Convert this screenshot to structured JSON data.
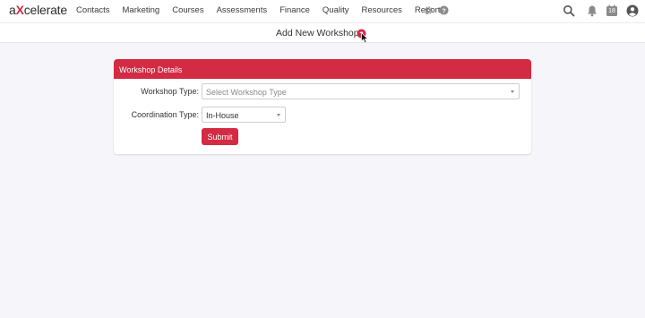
{
  "app": {
    "logo_prefix": "a",
    "logo_x": "X",
    "logo_suffix": "celerate"
  },
  "nav": {
    "items": [
      "Contacts",
      "Marketing",
      "Courses",
      "Assessments",
      "Finance",
      "Quality",
      "Resources",
      "Reports"
    ],
    "calendar_day": "18"
  },
  "page": {
    "title": "Add New Workshop"
  },
  "form": {
    "header": "Workshop Details",
    "required_marker": "*",
    "workshop_type_label": "Workshop Type:",
    "workshop_type_placeholder": "Select Workshop Type",
    "coordination_type_label": "Coordination Type:",
    "coordination_type_value": "In-House",
    "submit_label": "Submit"
  },
  "colors": {
    "brand": "#d22b43",
    "background": "#f6f5f9"
  }
}
